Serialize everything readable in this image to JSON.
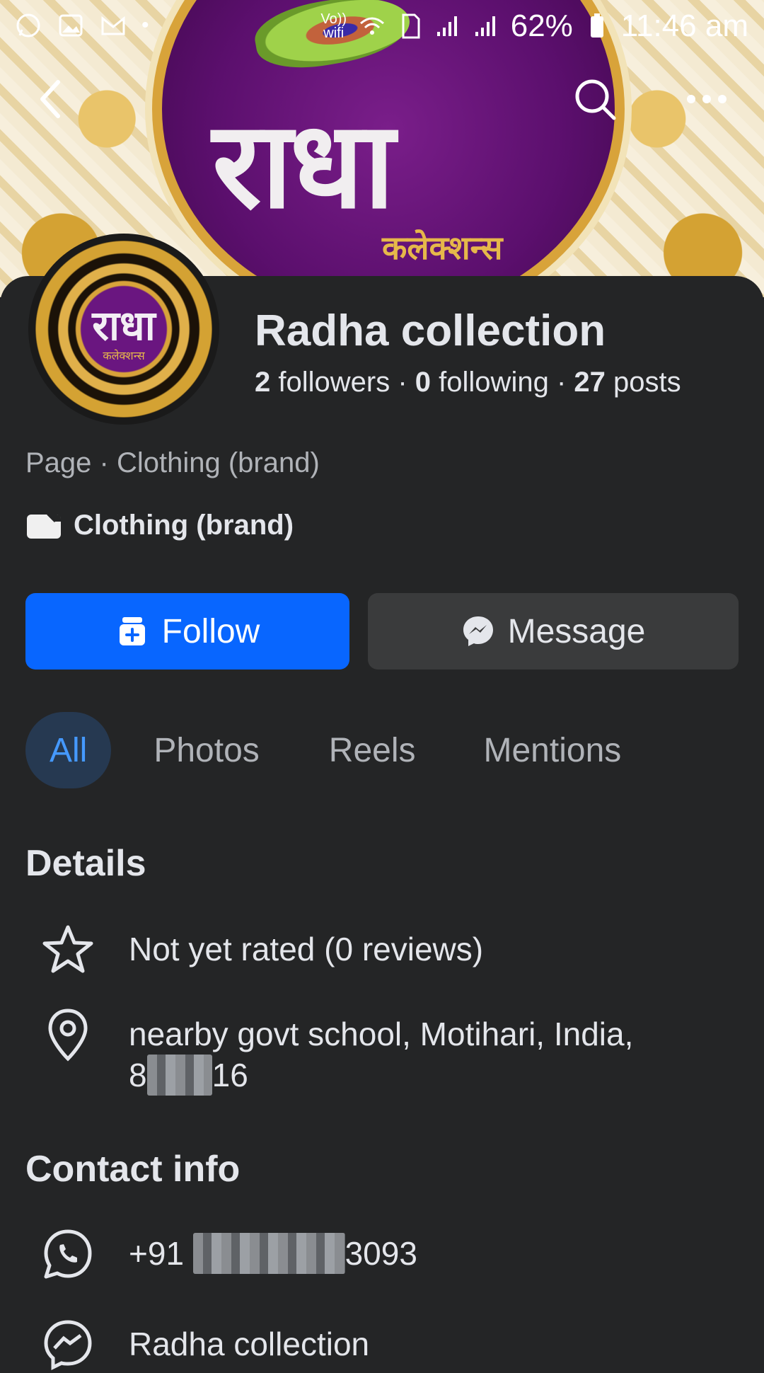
{
  "status_bar": {
    "network_label": "Vo)) wifi",
    "battery": "62%",
    "time": "11:46 am"
  },
  "cover": {
    "title_text": "राधा",
    "subtitle_text": "कलेक्शन्स"
  },
  "avatar": {
    "title_text": "राधा",
    "subtitle_text": "कलेक्शन्स"
  },
  "profile": {
    "name": "Radha collection",
    "followers_count": "2",
    "followers_label": "followers",
    "following_count": "0",
    "following_label": "following",
    "posts_count": "27",
    "posts_label": "posts",
    "separator": "·",
    "page_category": "Page · Clothing (brand)",
    "brand_label": "Clothing (brand)"
  },
  "actions": {
    "follow_label": "Follow",
    "message_label": "Message"
  },
  "tabs": [
    {
      "label": "All",
      "active": true
    },
    {
      "label": "Photos",
      "active": false
    },
    {
      "label": "Reels",
      "active": false
    },
    {
      "label": "Mentions",
      "active": false
    }
  ],
  "details": {
    "heading": "Details",
    "rating": "Not yet rated (0 reviews)",
    "address_line1": "nearby govt school, Motihari, India,",
    "address_prefix": "8",
    "address_suffix": "16"
  },
  "contact": {
    "heading": "Contact info",
    "phone_prefix": "+91",
    "phone_suffix": "3093",
    "messenger_name": "Radha collection"
  },
  "icons": {
    "back": "back-arrow-icon",
    "search": "search-icon",
    "more": "more-icon",
    "follow": "follow-icon",
    "messenger": "messenger-icon",
    "star": "star-icon",
    "location": "location-pin-icon",
    "whatsapp": "whatsapp-icon",
    "brand": "clapperboard-icon"
  },
  "colors": {
    "background": "#242526",
    "accent_blue": "#0866ff",
    "tab_active_bg": "#263951",
    "tab_active_text": "#4599ff"
  }
}
